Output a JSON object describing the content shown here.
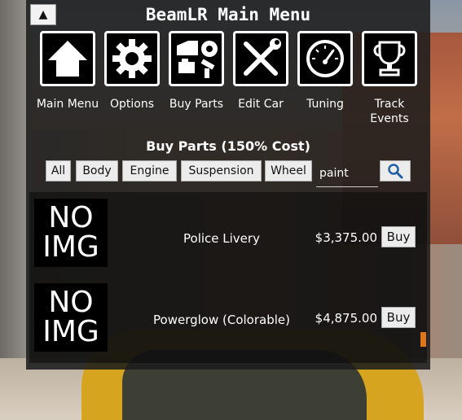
{
  "window": {
    "title": "BeamLR Main Menu",
    "collapse_glyph": "▲"
  },
  "menu": [
    {
      "label": "Main Menu",
      "icon": "home-icon"
    },
    {
      "label": "Options",
      "icon": "gear-icon"
    },
    {
      "label": "Buy Parts",
      "icon": "car-parts-icon"
    },
    {
      "label": "Edit Car",
      "icon": "tools-icon"
    },
    {
      "label": "Tuning",
      "icon": "gauge-icon"
    },
    {
      "label": "Track Events",
      "icon": "trophy-icon"
    }
  ],
  "section_title": "Buy Parts (150% Cost)",
  "filters": [
    "All",
    "Body",
    "Engine",
    "Suspension",
    "Wheel"
  ],
  "search": {
    "value": "paint",
    "icon": "search-icon"
  },
  "parts": [
    {
      "img_line1": "NO",
      "img_line2": "IMG",
      "name": "Police Livery",
      "price": "$3,375.00",
      "buy_label": "Buy"
    },
    {
      "img_line1": "NO",
      "img_line2": "IMG",
      "name": "Powerglow (Colorable)",
      "price": "$4,875.00",
      "buy_label": "Buy"
    }
  ],
  "colors": {
    "panel": "#1c1c1c",
    "scroll_thumb": "#e0761a",
    "button": "#ececec"
  }
}
